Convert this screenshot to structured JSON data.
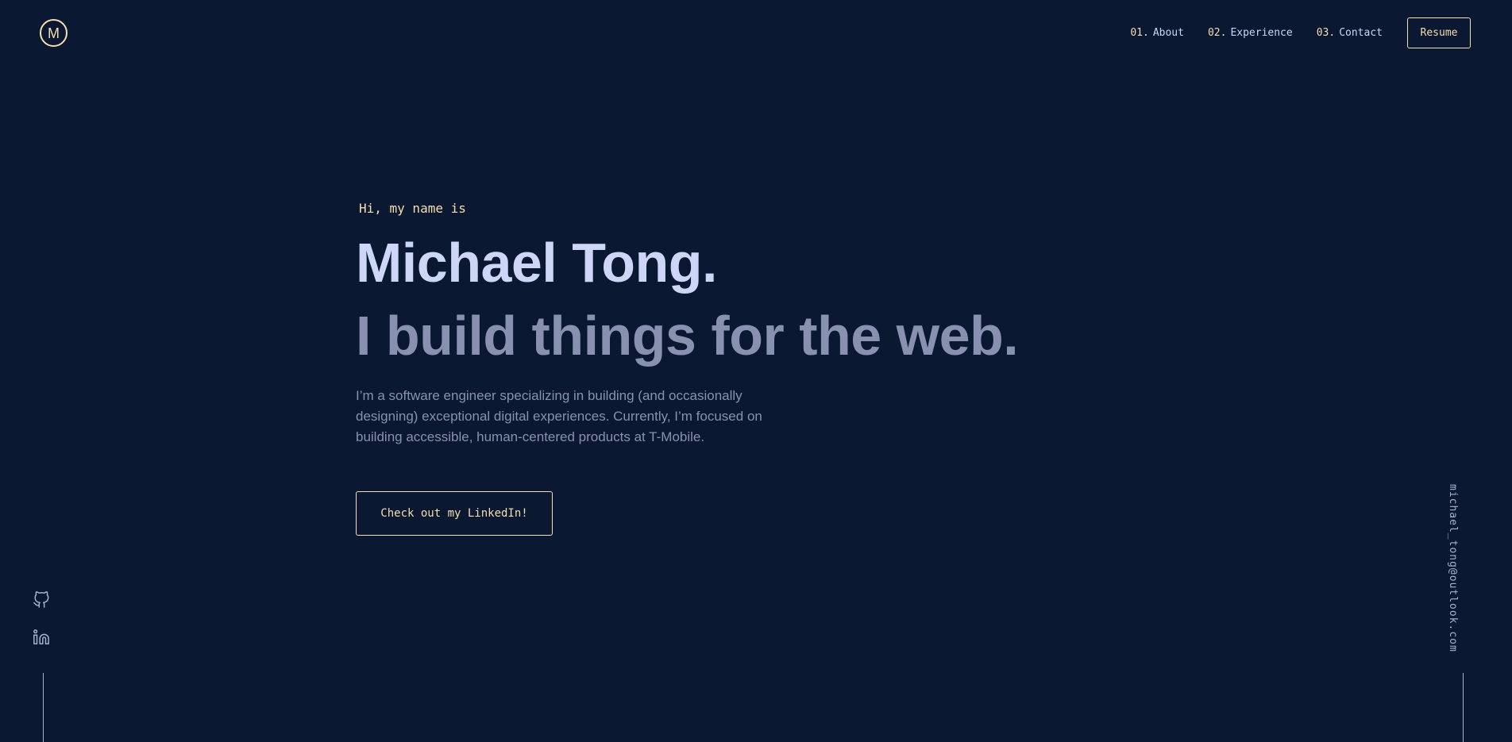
{
  "logo": {
    "letter": "M"
  },
  "nav": {
    "items": [
      {
        "num": "01.",
        "label": "About"
      },
      {
        "num": "02.",
        "label": "Experience"
      },
      {
        "num": "03.",
        "label": "Contact"
      }
    ],
    "resume_label": "Resume"
  },
  "hero": {
    "greeting": "Hi, my name is",
    "name": "Michael Tong.",
    "tagline": "I build things for the web.",
    "bio": "I’m a software engineer specializing in building (and occasionally designing) exceptional digital experiences. Currently, I’m focused on building accessible, human-centered products at T-Mobile.",
    "cta_label": "Check out my LinkedIn!"
  },
  "social": {
    "icons": [
      "github-icon",
      "linkedin-icon"
    ]
  },
  "email": "michael_tong@outlook.com",
  "colors": {
    "background": "#0b1832",
    "accent": "#f5deb0",
    "heading": "#cdd6f6",
    "text": "#8892b0"
  }
}
